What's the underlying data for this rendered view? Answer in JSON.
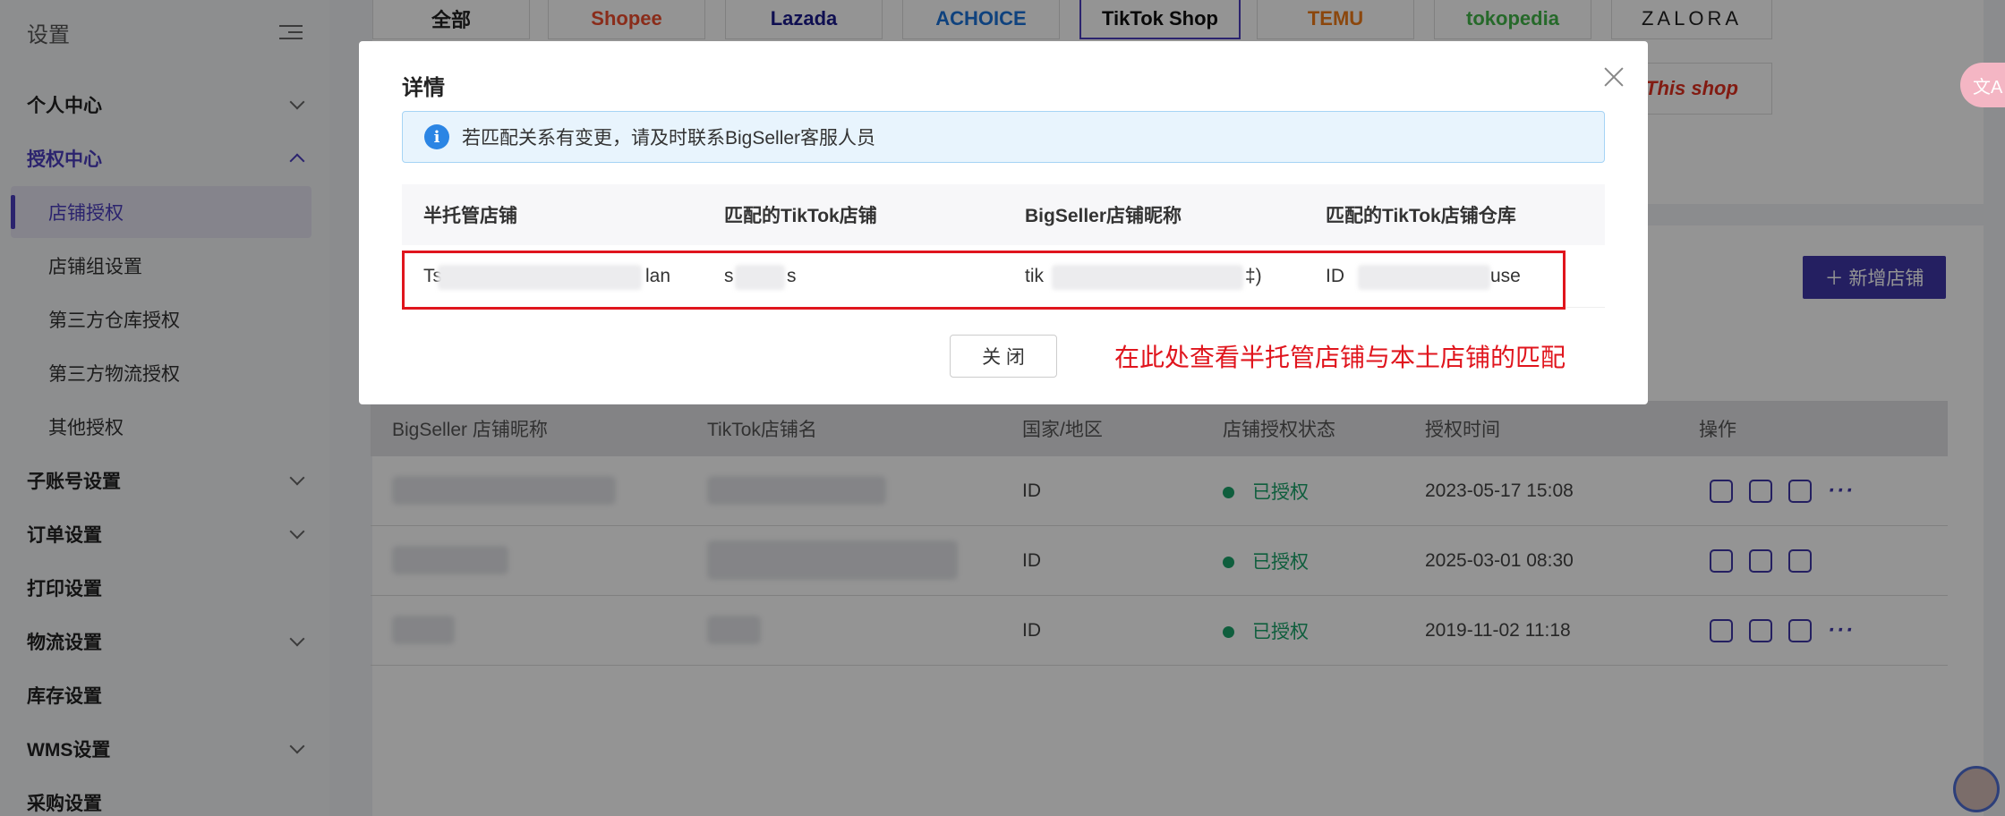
{
  "sidebar": {
    "title": "设置",
    "items": [
      {
        "label": "个人中心"
      },
      {
        "label": "授权中心"
      },
      {
        "label": "子账号设置"
      },
      {
        "label": "订单设置"
      },
      {
        "label": "打印设置"
      },
      {
        "label": "物流设置"
      },
      {
        "label": "库存设置"
      },
      {
        "label": "WMS设置"
      },
      {
        "label": "采购设置"
      }
    ],
    "sub_items": [
      {
        "label": "店铺授权"
      },
      {
        "label": "店铺组设置"
      },
      {
        "label": "第三方仓库授权"
      },
      {
        "label": "第三方物流授权"
      },
      {
        "label": "其他授权"
      }
    ]
  },
  "platforms": [
    {
      "label": "全部",
      "color": "#222222"
    },
    {
      "label": "Shopee",
      "color": "#ee4d2d"
    },
    {
      "label": "Lazada",
      "color": "#1a1a8c"
    },
    {
      "label": "ACHOICE",
      "color": "#1a73d9"
    },
    {
      "label": "TikTok Shop",
      "color": "#111111"
    },
    {
      "label": "TEMU",
      "color": "#f07b17"
    },
    {
      "label": "tokopedia",
      "color": "#42b549"
    },
    {
      "label": "ZALORA",
      "color": "#222222"
    },
    {
      "label": "This shop",
      "color": "#e1301f"
    }
  ],
  "add_store_button": "＋ 新增店铺",
  "table": {
    "headers": [
      "BigSeller 店铺昵称",
      "TikTok店铺名",
      "国家/地区",
      "店铺授权状态",
      "授权时间",
      "操作"
    ],
    "rows": [
      {
        "country": "ID",
        "status": "已授权",
        "time": "2023-05-17 15:08"
      },
      {
        "country": "ID",
        "status": "已授权",
        "time": "2025-03-01 08:30"
      },
      {
        "country": "ID",
        "status": "已授权",
        "time": "2019-11-02 11:18"
      }
    ]
  },
  "translate_label": "文A",
  "modal": {
    "title": "详情",
    "alert": "若匹配关系有变更，请及时联系BigSeller客服人员",
    "headers": [
      "半托管店铺",
      "匹配的TikTok店铺",
      "BigSeller店铺昵称",
      "匹配的TikTok店铺仓库"
    ],
    "row": {
      "c1_start": "Ts",
      "c1_end": "lan",
      "c2_start": "s",
      "c2_end": "s",
      "c3_start": "tik",
      "c3_end": "‡)",
      "c4_start": "ID",
      "c4_end": "use"
    },
    "close_button": "关 闭",
    "annotation": "在此处查看半托管店铺与本土店铺的匹配"
  }
}
